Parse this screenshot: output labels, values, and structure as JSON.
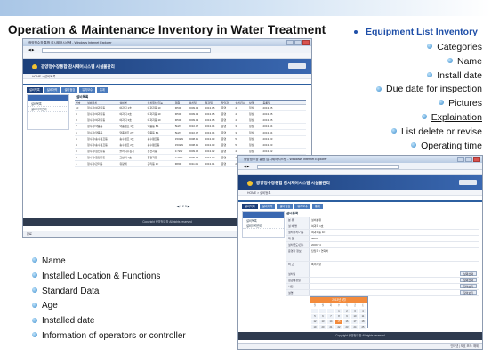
{
  "slide": {
    "title": "Operation & Maintenance Inventory in Water Treatment",
    "inventory_heading": "Equipment List Inventory",
    "right_items": [
      "Categories",
      "Name",
      "Install date",
      "Due date for inspection",
      "Pictures",
      "Explaination",
      "List delete or revise",
      "Operating time"
    ],
    "left_items": [
      "Name",
      "Installed Location & Functions",
      "Standard Data",
      "Age",
      "Installed date",
      "Information of operators or controller"
    ]
  },
  "win1": {
    "titlebar": "광양정수장 통합 감시제어시스템 - Windows Internet Explorer",
    "url": "http://localhost:8080/list.do",
    "banner": "광양정수장통합 감시제어시스템 시설물관리",
    "crumb": "HOME > 설비목록",
    "tabs": [
      "설비목록",
      "설비이력",
      "설비점검",
      "유지보수",
      "통계"
    ],
    "side_items": [
      "설비목록",
      "설비이력관리"
    ],
    "list_title": "설비목록",
    "columns": [
      "번호",
      "설비위치",
      "설비명",
      "설치위치/기능",
      "제원",
      "설치일",
      "점검일",
      "담당자",
      "설치년수",
      "상태",
      "등록일"
    ],
    "rows": [
      [
        "10",
        "정수장/여과지동",
        "여과지 1호",
        "여과지동 1F",
        "Φ500",
        "2009.03",
        "2013.05",
        "운영",
        "4",
        "정상",
        "2013.05"
      ],
      [
        "9",
        "정수장/여과지동",
        "여과지 2호",
        "여과지동 1F",
        "Φ500",
        "2009.03",
        "2013.05",
        "운영",
        "4",
        "정상",
        "2013.05"
      ],
      [
        "8",
        "정수장/여과지동",
        "여과지 3호",
        "여과지동 1F",
        "Φ500",
        "2009.03",
        "2013.05",
        "운영",
        "4",
        "정상",
        "2013.05"
      ],
      [
        "7",
        "정수장/약품동",
        "약품펌프 1호",
        "약품동 B1",
        "5kW",
        "2010.07",
        "2013.04",
        "운영",
        "3",
        "정상",
        "2013.04"
      ],
      [
        "6",
        "정수장/약품동",
        "약품펌프 2호",
        "약품동 B1",
        "5kW",
        "2010.07",
        "2013.04",
        "운영",
        "3",
        "정상",
        "2013.04"
      ],
      [
        "5",
        "정수장/송수펌프동",
        "송수펌프 1호",
        "송수펌프동",
        "150kW",
        "2008.11",
        "2013.03",
        "운영",
        "5",
        "정상",
        "2013.03"
      ],
      [
        "4",
        "정수장/송수펌프동",
        "송수펌프 2호",
        "송수펌프동",
        "150kW",
        "2008.11",
        "2013.03",
        "운영",
        "5",
        "정상",
        "2013.03"
      ],
      [
        "3",
        "정수장/침전지동",
        "슬러지수집기",
        "침전지동",
        "3.7kW",
        "2009.06",
        "2013.02",
        "운영",
        "4",
        "정상",
        "2013.02"
      ],
      [
        "2",
        "정수장/침전지동",
        "교반기 1호",
        "침전지동",
        "2.2kW",
        "2009.06",
        "2013.02",
        "운영",
        "4",
        "정상",
        "2013.02"
      ],
      [
        "1",
        "정수장/관리동",
        "유량계",
        "관리동 1F",
        "Φ800",
        "2011.01",
        "2013.01",
        "운영",
        "2",
        "정상",
        "2013.01"
      ]
    ],
    "pager": "◀ 1 2 3 ▶",
    "footer": "Copyright 광양정수장 All rights reserved",
    "status_left": "완료",
    "status_right": "인터넷 | 보호 모드: 해제"
  },
  "win2": {
    "titlebar": "광양정수장 통합 감시제어시스템 - Windows Internet Explorer",
    "url": "http://localhost:8080/regist.do",
    "banner": "광양정수장통합 감시제어시스템 시설물관리",
    "crumb": "HOME > 설비등록",
    "tabs": [
      "설비목록",
      "설비이력",
      "설비점검",
      "유지보수",
      "통계"
    ],
    "side_items": [
      "설비목록",
      "설비이력관리"
    ],
    "form_title": "설비등록",
    "fields": [
      {
        "label": "분 류",
        "value": "설비분류"
      },
      {
        "label": "설 비 명",
        "value": "여과지 1호"
      },
      {
        "label": "설치위치/기능",
        "value": "여과지동 1F"
      },
      {
        "label": "제 원",
        "value": "Φ500"
      },
      {
        "label": "설치년도/년수",
        "value": "2009 / 4"
      },
      {
        "label": "운영자 정보",
        "value": "담당자 / 연락처"
      },
      {
        "label": "비 고",
        "value": "특이사항"
      }
    ],
    "lower_fields": [
      {
        "label": "설치일",
        "button": "날짜선택"
      },
      {
        "label": "점검예정일",
        "button": "날짜선택"
      },
      {
        "label": "사진",
        "button": "찾아보기"
      },
      {
        "label": "설명",
        "button": "찾아보기"
      }
    ],
    "calendar_title": "2013년 5월",
    "calendar_days": [
      "일",
      "월",
      "화",
      "수",
      "목",
      "금",
      "토"
    ],
    "calendar_dates": [
      "",
      "",
      "",
      "1",
      "2",
      "3",
      "4",
      "5",
      "6",
      "7",
      "8",
      "9",
      "10",
      "11",
      "12",
      "13",
      "14",
      "15",
      "16",
      "17",
      "18",
      "19",
      "20",
      "21",
      "22",
      "23",
      "24",
      "25"
    ],
    "calendar_selected": "15",
    "footer": "Copyright 광양정수장 All rights reserved",
    "status_right": "인터넷 | 보호 모드: 해제"
  }
}
